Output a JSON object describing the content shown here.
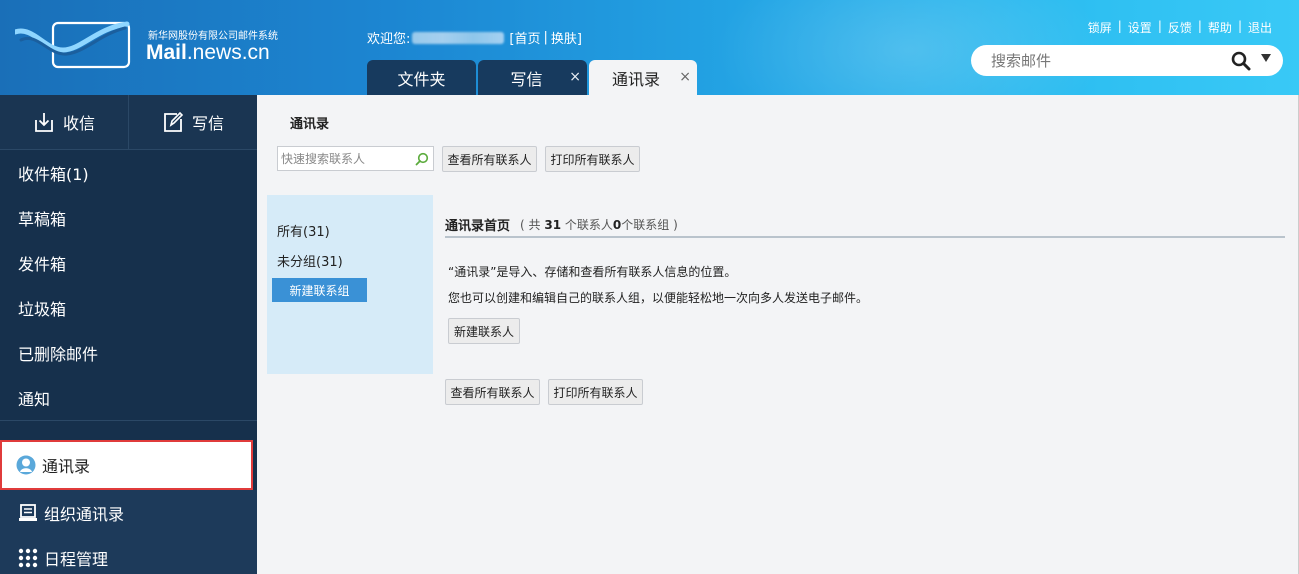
{
  "app": {
    "brand_small": "新华网股份有限公司邮件系统",
    "brand_domain_bold": "Mail",
    "brand_domain_rest": ".news.cn"
  },
  "header": {
    "welcome_prefix": "欢迎您:",
    "home_link": "[首页",
    "sep": "|",
    "skin_link": "换肤]",
    "tabs": [
      {
        "label": "文件夹",
        "closable": false,
        "active": false
      },
      {
        "label": "写信",
        "closable": true,
        "active": false
      },
      {
        "label": "通讯录",
        "closable": true,
        "active": true
      }
    ],
    "close_glyph": "×",
    "top_links": [
      "锁屏",
      "|",
      "设置",
      "|",
      "反馈",
      "|",
      "帮助",
      "|",
      "退出"
    ],
    "search_placeholder": "搜索邮件"
  },
  "sidebar": {
    "receive": "收信",
    "compose": "写信",
    "folders": [
      "收件箱(1)",
      "草稿箱",
      "发件箱",
      "垃圾箱",
      "已删除邮件",
      "通知"
    ],
    "tools": [
      {
        "label": "通讯录",
        "icon": "contact-icon",
        "active": true
      },
      {
        "label": "组织通讯录",
        "icon": "org-address-icon",
        "active": false
      },
      {
        "label": "日程管理",
        "icon": "grid-icon",
        "active": false
      }
    ]
  },
  "main": {
    "title": "通讯录",
    "quick_search_placeholder": "快速搜索联系人",
    "view_all": "查看所有联系人",
    "print_all": "打印所有联系人",
    "groups": {
      "all": "所有(31)",
      "ungrouped": "未分组(31)",
      "new_group": "新建联系组"
    },
    "panel": {
      "heading": "通讯录首页",
      "count_prefix": "( 共",
      "contact_count": "31",
      "count_mid": "个联系人",
      "group_count": "0",
      "count_suffix": "个联系组 )",
      "desc1": "“通讯录”是导入、存储和查看所有联系人信息的位置。",
      "desc2": "您也可以创建和编辑自己的联系人组，以便能轻松地一次向多人发送电子邮件。",
      "new_contact": "新建联系人"
    }
  },
  "colors": {
    "sidebar_bg": "#16304c",
    "accent_blue": "#3a91d6",
    "active_border": "#e03b3b"
  }
}
